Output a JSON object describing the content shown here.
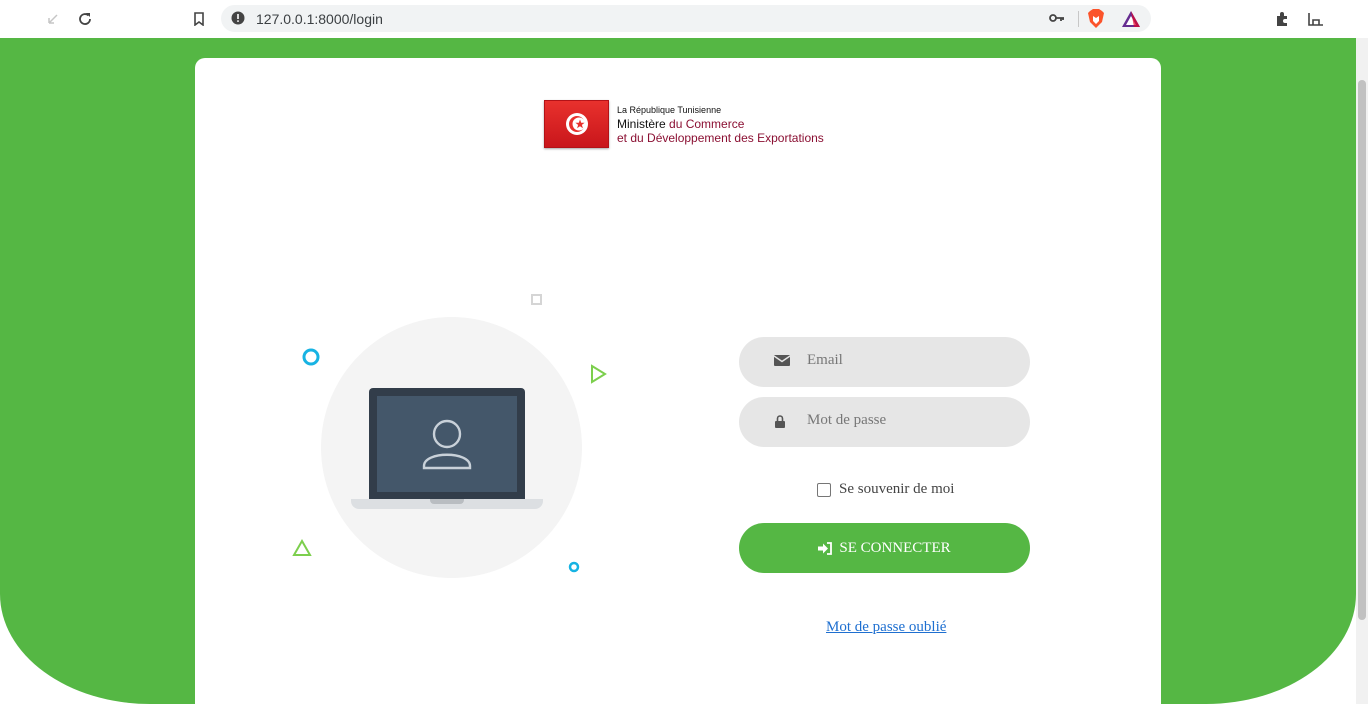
{
  "browser": {
    "url": "127.0.0.1:8000/login"
  },
  "header": {
    "logo_line1": "La République Tunisienne",
    "logo_line2a": "Ministère ",
    "logo_line2b": "du Commerce",
    "logo_line3": "et du Développement des Exportations"
  },
  "form": {
    "email_placeholder": "Email",
    "password_placeholder": "Mot de passe",
    "remember_label": "Se souvenir de moi",
    "remember_checked": false,
    "submit_label": "SE CONNECTER",
    "forgot_label": "Mot de passe oublié"
  },
  "colors": {
    "brand_green": "#55b744",
    "link_blue": "#1e6fd0",
    "flag_red": "#e8312d"
  },
  "icons": [
    "back-icon",
    "reload-icon",
    "bookmark-icon",
    "site-info-icon",
    "key-icon",
    "brave-shield-icon",
    "brave-rewards-icon",
    "extensions-icon",
    "menu-icon",
    "envelope-icon",
    "lock-icon",
    "sign-in-icon",
    "user-icon"
  ]
}
